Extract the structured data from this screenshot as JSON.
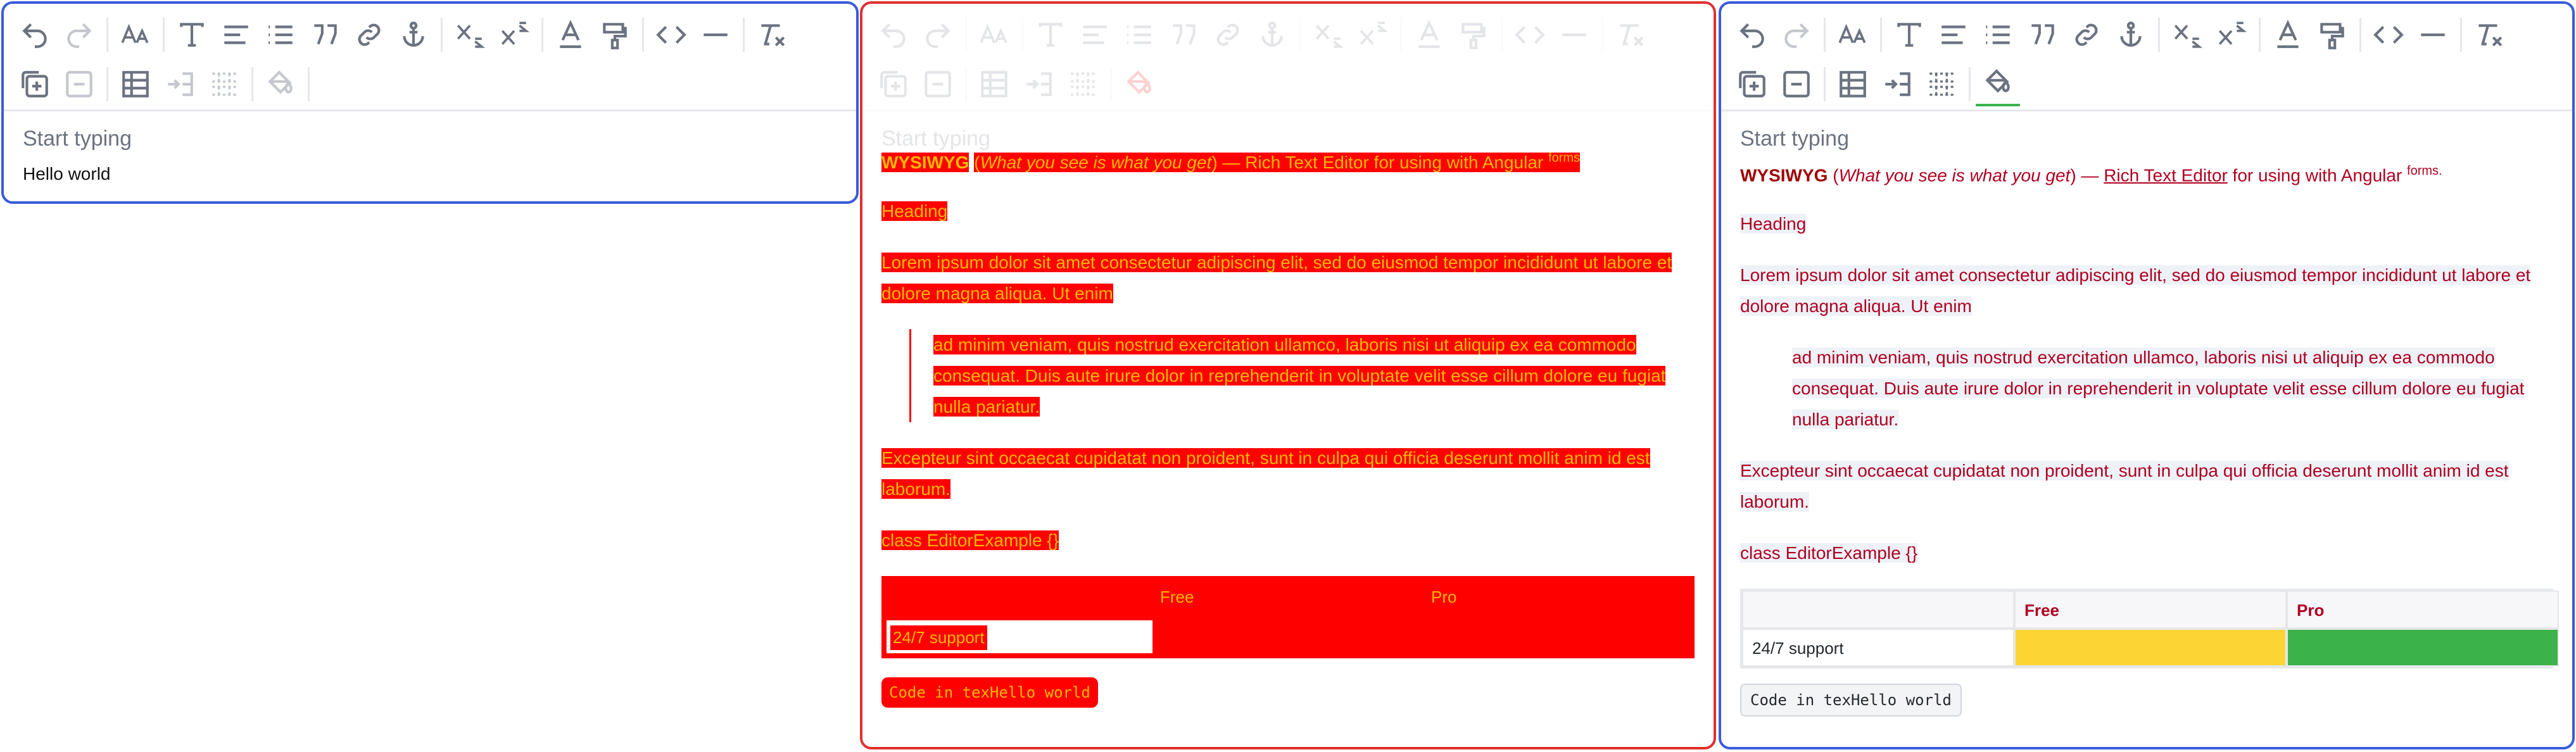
{
  "editor1": {
    "placeholder": "Start typing",
    "content_text": "Hello world"
  },
  "editor2": {
    "placeholder": "Start typing",
    "title_prefix": "WYSIWYG",
    "title_italic": "What you see is what you get",
    "title_rest": " — Rich Text Editor for using with Angular",
    "title_sup": "forms",
    "heading": "Heading",
    "para1": "Lorem ipsum dolor sit amet consectetur adipiscing elit, sed do eiusmod tempor incididunt ut labore et dolore magna aliqua. Ut enim",
    "quote": "ad minim veniam, quis nostrud exercitation ullamco, laboris nisi ut aliquip ex ea commodo consequat. Duis aute irure dolor in reprehenderit in voluptate velit esse cillum dolore eu fugiat nulla pariatur.",
    "para2": "Excepteur sint occaecat cupidatat non proident, sunt in culpa qui officia deserunt mollit anim id est laborum.",
    "code_line": "class EditorExample {}",
    "table_headers": [
      "",
      "Free",
      "Pro"
    ],
    "table_row": [
      "24/7 support",
      "",
      ""
    ],
    "code_box": "Code in texHello world"
  },
  "editor3": {
    "placeholder": "Start typing",
    "title_prefix": "WYSIWYG",
    "title_italic": "What you see is what you get",
    "title_link": "Rich Text Editor",
    "title_rest": "for using with Angular",
    "title_sup": "forms.",
    "heading": "Heading",
    "para1": "Lorem ipsum dolor sit amet consectetur adipiscing elit, sed do eiusmod tempor incididunt ut labore et dolore magna aliqua. Ut enim",
    "quote": "ad minim veniam, quis nostrud exercitation ullamco, laboris nisi ut aliquip ex ea commodo consequat. Duis aute irure dolor in reprehenderit in voluptate velit esse cillum dolore eu fugiat nulla pariatur.",
    "para2": "Excepteur sint occaecat cupidatat non proident, sunt in culpa qui officia deserunt mollit anim id est laborum.",
    "code_line": "class EditorExample {}",
    "table_headers": [
      "",
      "Free",
      "Pro"
    ],
    "table_row": [
      "24/7 support",
      "",
      ""
    ],
    "code_box": "Code in texHello world"
  },
  "colors": {
    "editor_border_blue": "#3b5bdb",
    "editor_border_red": "#e03131",
    "highlight_red": "#ff0000",
    "highlight_text": "#ffb800",
    "cell_yellow": "#fcd535",
    "cell_green": "#3cb34a"
  },
  "toolbar_icons": [
    "undo-icon",
    "redo-icon",
    "font-size-icon",
    "text-format-icon",
    "align-icon",
    "list-icon",
    "quote-icon",
    "link-icon",
    "anchor-icon",
    "subscript-icon",
    "superscript-icon",
    "text-color-icon",
    "highlight-color-icon",
    "code-icon",
    "horizontal-rule-icon",
    "clear-format-icon",
    "insert-table-icon",
    "delete-table-icon",
    "table-icon",
    "merge-cells-icon",
    "split-cells-icon",
    "cell-color-icon"
  ]
}
